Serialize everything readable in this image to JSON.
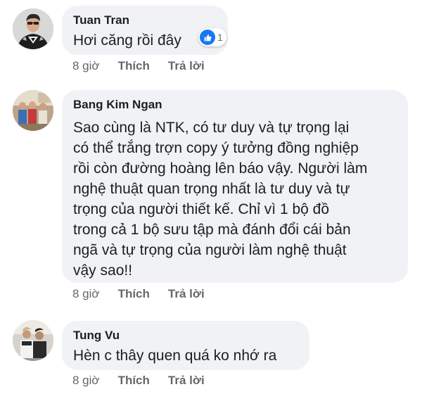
{
  "comments": [
    {
      "author": "Tuan Tran",
      "lines": [
        "Hơi căng rồi đây"
      ],
      "reactions": {
        "icon": "like-icon",
        "count": "1",
        "color": "#1877f2"
      },
      "time": "8 giờ",
      "like_label": "Thích",
      "reply_label": "Trả lời"
    },
    {
      "author": "Bang Kim Ngan",
      "lines": [
        "Sao cùng là NTK, có tư duy và tự trọng lại",
        "có thể trắng trợn copy ý tưởng đồng nghiệp",
        "rồi còn đường hoàng lên báo vậy. Người làm",
        "nghệ thuật quan trọng nhất là tư duy và tự",
        "trọng của người thiết kế. Chỉ vì 1 bộ đồ",
        "trong cả 1 bộ sưu tập mà đánh đổi cái bản",
        "ngã và tự trọng của người làm nghệ thuật",
        "vậy sao!!"
      ],
      "time": "8 giờ",
      "like_label": "Thích",
      "reply_label": "Trả lời"
    },
    {
      "author": "Tung Vu",
      "lines": [
        "Hèn c thây quen quá ko nhớ ra"
      ],
      "time": "8 giờ",
      "like_label": "Thích",
      "reply_label": "Trả lời"
    }
  ],
  "colors": {
    "bubble": "#f0f2f5",
    "meta_text": "#65676b",
    "body_text": "#1c1e21",
    "like_blue": "#1877f2"
  }
}
